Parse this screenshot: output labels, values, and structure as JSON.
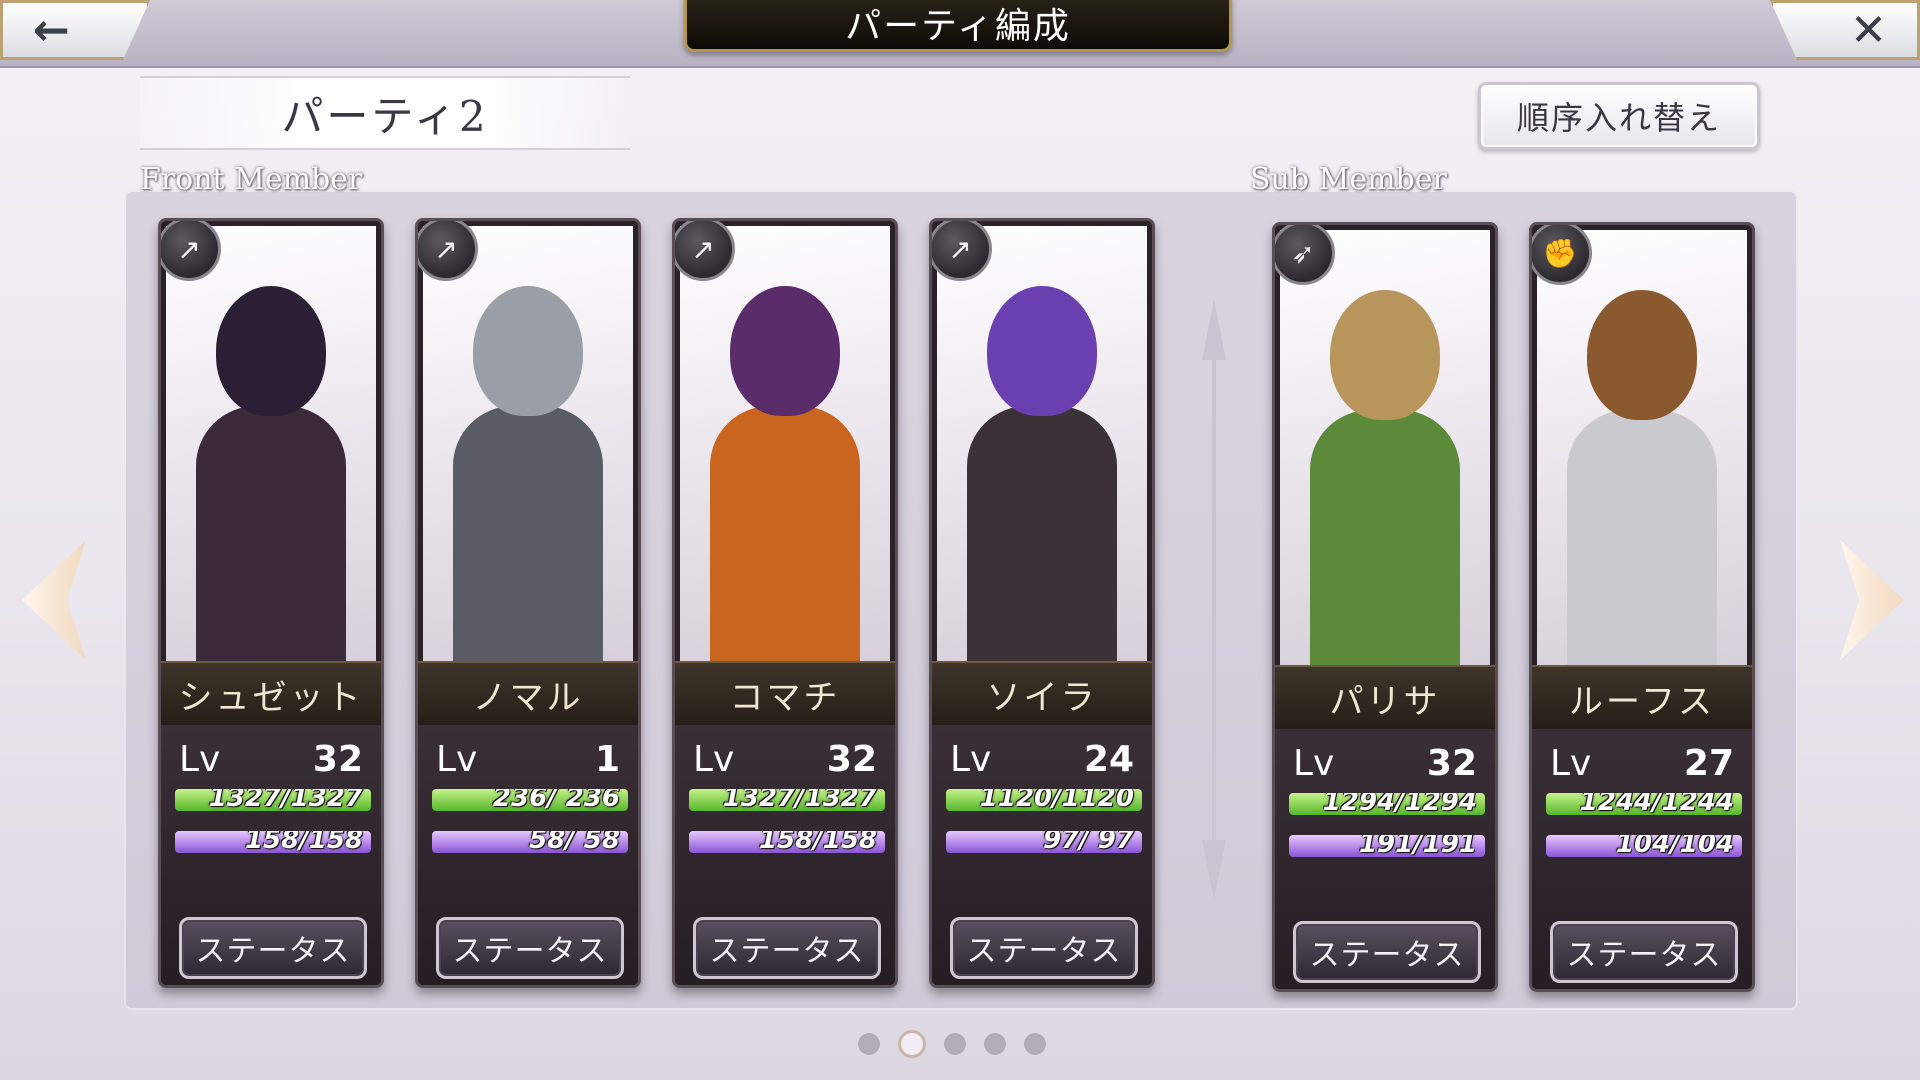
{
  "header": {
    "back_icon": "arrow-left-icon",
    "title": "パーティ編成",
    "close_icon": "close-x-icon"
  },
  "party": {
    "name": "パーティ2",
    "reorder_label": "順序入れ替え",
    "front_label": "Front Member",
    "sub_label": "Sub Member"
  },
  "colors": {
    "hp": "#56b62b",
    "mp": "#8a55d6",
    "card_bg": "#2a2228",
    "accent_gold": "#b5964e"
  },
  "front_members": [
    {
      "name": "シュゼット",
      "lv_label": "Lv",
      "level": "32",
      "hp": "1327/1327",
      "mp": "158/158",
      "hp_fraction": 1.0,
      "mp_fraction": 1.0,
      "role_icon": "spear-icon",
      "status_label": "ステータス",
      "hair": "#2b1f35",
      "outfit": "#3a2a3a"
    },
    {
      "name": "ノマル",
      "lv_label": "Lv",
      "level": "1",
      "hp": "236/ 236",
      "mp": "58/ 58",
      "hp_fraction": 1.0,
      "mp_fraction": 1.0,
      "role_icon": "spear-icon",
      "status_label": "ステータス",
      "hair": "#9a9ea6",
      "outfit": "#5a5c64"
    },
    {
      "name": "コマチ",
      "lv_label": "Lv",
      "level": "32",
      "hp": "1327/1327",
      "mp": "158/158",
      "hp_fraction": 1.0,
      "mp_fraction": 1.0,
      "role_icon": "spear-icon",
      "status_label": "ステータス",
      "hair": "#5a2d6a",
      "outfit": "#c9651f"
    },
    {
      "name": "ソイラ",
      "lv_label": "Lv",
      "level": "24",
      "hp": "1120/1120",
      "mp": "97/ 97",
      "hp_fraction": 1.0,
      "mp_fraction": 1.0,
      "role_icon": "spear-icon",
      "status_label": "ステータス",
      "hair": "#6a3fb0",
      "outfit": "#3a3236"
    }
  ],
  "sub_members": [
    {
      "name": "パリサ",
      "lv_label": "Lv",
      "level": "32",
      "hp": "1294/1294",
      "mp": "191/191",
      "hp_fraction": 1.0,
      "mp_fraction": 1.0,
      "role_icon": "bow-icon",
      "status_label": "ステータス",
      "hair": "#b8955a",
      "outfit": "#5a8a3a"
    },
    {
      "name": "ルーフス",
      "lv_label": "Lv",
      "level": "27",
      "hp": "1244/1244",
      "mp": "104/104",
      "hp_fraction": 1.0,
      "mp_fraction": 1.0,
      "role_icon": "fist-icon",
      "status_label": "ステータス",
      "hair": "#8a5a2e",
      "outfit": "#c9c9cf"
    }
  ],
  "pagination": {
    "pages": 5,
    "active": 2
  },
  "nav": {
    "prev_icon": "chevron-left-icon",
    "next_icon": "chevron-right-icon"
  }
}
